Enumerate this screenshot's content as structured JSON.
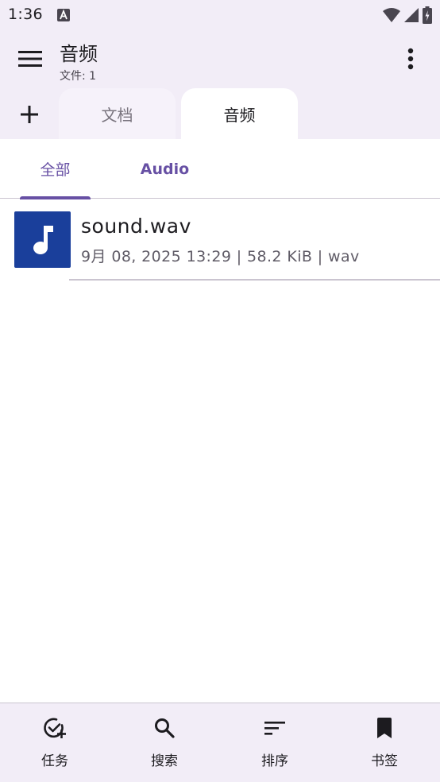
{
  "status_bar": {
    "time": "1:36"
  },
  "app_bar": {
    "title": "音频",
    "subtitle": "文件: 1"
  },
  "doc_tabs": [
    {
      "label": "文档",
      "active": false
    },
    {
      "label": "音频",
      "active": true
    }
  ],
  "sub_tabs": [
    {
      "label": "全部",
      "active": true
    },
    {
      "label": "Audio",
      "active": false
    }
  ],
  "files": [
    {
      "name": "sound.wav",
      "meta": "9月 08, 2025 13:29 | 58.2 KiB | wav",
      "icon": "music-note-icon",
      "thumb_color": "#1a3f9b"
    }
  ],
  "bottom_nav": [
    {
      "label": "任务",
      "icon": "task-add-icon"
    },
    {
      "label": "搜索",
      "icon": "search-icon"
    },
    {
      "label": "排序",
      "icon": "sort-icon"
    },
    {
      "label": "书签",
      "icon": "bookmark-icon"
    }
  ],
  "colors": {
    "accent": "#6750a4",
    "surface": "#f2edf7",
    "thumb": "#1a3f9b"
  }
}
